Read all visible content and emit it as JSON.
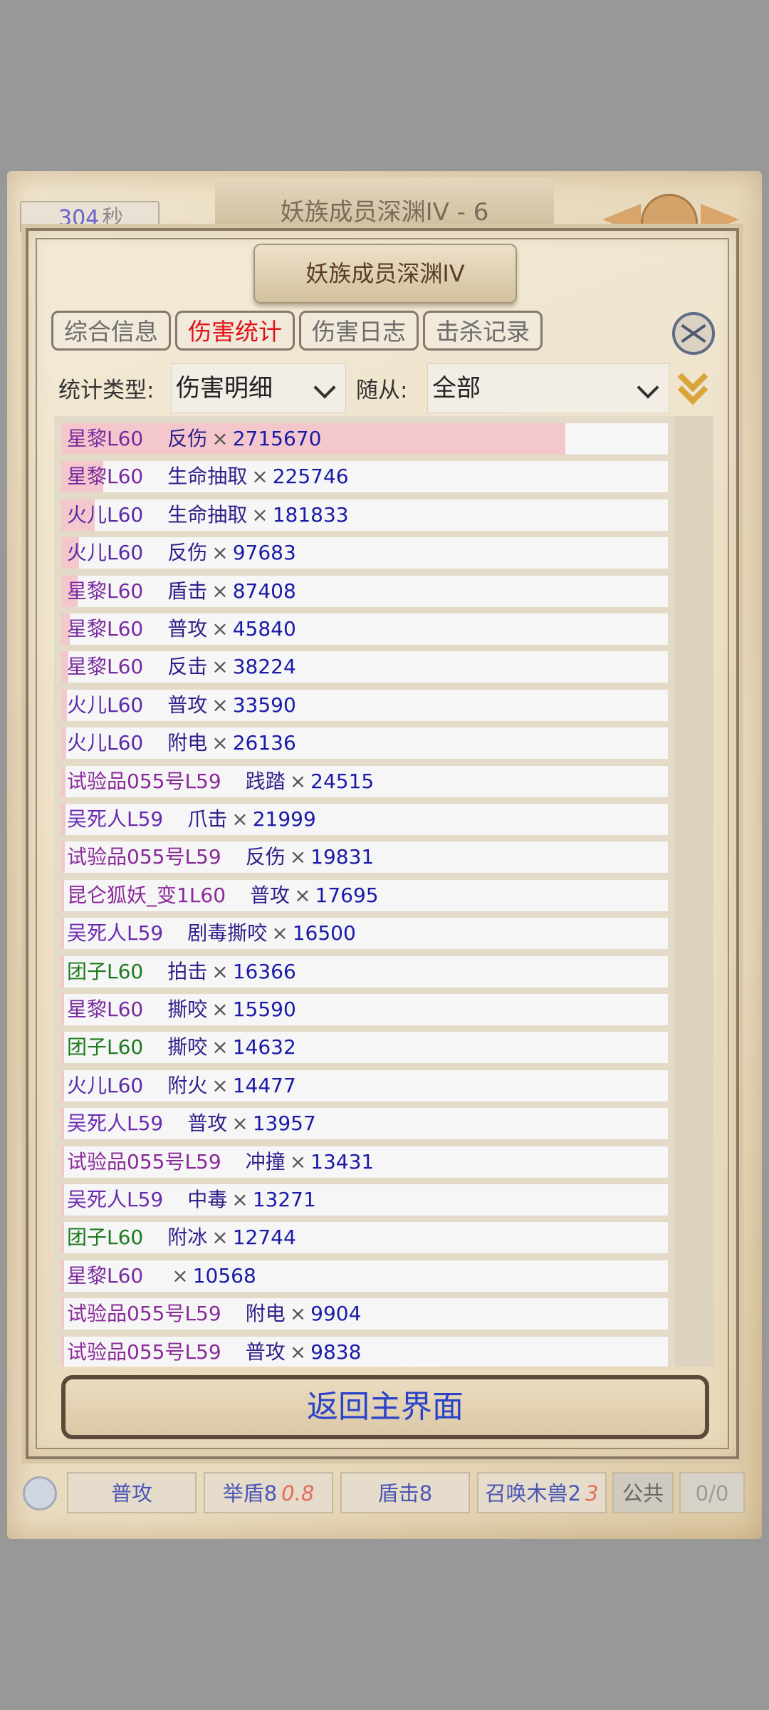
{
  "background": {
    "timer_value": "304",
    "timer_unit": "秒",
    "title": "妖族成员深渊IV - 6",
    "level": "4"
  },
  "dialog": {
    "title": "妖族成员深渊IV",
    "tabs": [
      {
        "label": "综合信息",
        "active": false
      },
      {
        "label": "伤害统计",
        "active": true
      },
      {
        "label": "伤害日志",
        "active": false
      },
      {
        "label": "击杀记录",
        "active": false
      }
    ],
    "filters": {
      "type_label": "统计类型:",
      "type_value": "伤害明细",
      "follower_label": "随从:",
      "follower_value": "全部"
    },
    "rows": [
      {
        "name": "星黎L60",
        "name_color": "#7a2aa0",
        "skill": "反伤",
        "value": "2715670",
        "fill": 1.0
      },
      {
        "name": "星黎L60",
        "name_color": "#7a2aa0",
        "skill": "生命抽取",
        "value": "225746",
        "fill": 0.083
      },
      {
        "name": "火儿L60",
        "name_color": "#5a2aa8",
        "skill": "生命抽取",
        "value": "181833",
        "fill": 0.067
      },
      {
        "name": "火儿L60",
        "name_color": "#5a2aa8",
        "skill": "反伤",
        "value": "97683",
        "fill": 0.036
      },
      {
        "name": "星黎L60",
        "name_color": "#7a2aa0",
        "skill": "盾击",
        "value": "87408",
        "fill": 0.032
      },
      {
        "name": "星黎L60",
        "name_color": "#7a2aa0",
        "skill": "普攻",
        "value": "45840",
        "fill": 0.017
      },
      {
        "name": "星黎L60",
        "name_color": "#7a2aa0",
        "skill": "反击",
        "value": "38224",
        "fill": 0.014
      },
      {
        "name": "火儿L60",
        "name_color": "#5a2aa8",
        "skill": "普攻",
        "value": "33590",
        "fill": 0.012
      },
      {
        "name": "火儿L60",
        "name_color": "#5a2aa8",
        "skill": "附电",
        "value": "26136",
        "fill": 0.01
      },
      {
        "name": "试验品055号L59",
        "name_color": "#8a2a9a",
        "skill": "践踏",
        "value": "24515",
        "fill": 0.009
      },
      {
        "name": "吴死人L59",
        "name_color": "#6a2ab0",
        "skill": "爪击",
        "value": "21999",
        "fill": 0.008
      },
      {
        "name": "试验品055号L59",
        "name_color": "#8a2a9a",
        "skill": "反伤",
        "value": "19831",
        "fill": 0.007
      },
      {
        "name": "昆仑狐妖_变1L60",
        "name_color": "#8a2a9a",
        "skill": "普攻",
        "value": "17695",
        "fill": 0.006
      },
      {
        "name": "吴死人L59",
        "name_color": "#6a2ab0",
        "skill": "剧毒撕咬",
        "value": "16500",
        "fill": 0.006
      },
      {
        "name": "团子L60",
        "name_color": "#1e7a1e",
        "skill": "拍击",
        "value": "16366",
        "fill": 0.006
      },
      {
        "name": "星黎L60",
        "name_color": "#7a2aa0",
        "skill": "撕咬",
        "value": "15590",
        "fill": 0.006
      },
      {
        "name": "团子L60",
        "name_color": "#1e7a1e",
        "skill": "撕咬",
        "value": "14632",
        "fill": 0.005
      },
      {
        "name": "火儿L60",
        "name_color": "#5a2aa8",
        "skill": "附火",
        "value": "14477",
        "fill": 0.005
      },
      {
        "name": "吴死人L59",
        "name_color": "#6a2ab0",
        "skill": "普攻",
        "value": "13957",
        "fill": 0.005
      },
      {
        "name": "试验品055号L59",
        "name_color": "#8a2a9a",
        "skill": "冲撞",
        "value": "13431",
        "fill": 0.005
      },
      {
        "name": "吴死人L59",
        "name_color": "#6a2ab0",
        "skill": "中毒",
        "value": "13271",
        "fill": 0.005
      },
      {
        "name": "团子L60",
        "name_color": "#1e7a1e",
        "skill": "附冰",
        "value": "12744",
        "fill": 0.005
      },
      {
        "name": "星黎L60",
        "name_color": "#7a2aa0",
        "skill": "",
        "value": "10568",
        "fill": 0.004
      },
      {
        "name": "试验品055号L59",
        "name_color": "#8a2a9a",
        "skill": "附电",
        "value": "9904",
        "fill": 0.004
      },
      {
        "name": "试验品055号L59",
        "name_color": "#8a2a9a",
        "skill": "普攻",
        "value": "9838",
        "fill": 0.004
      }
    ],
    "times_symbol": "×",
    "return_label": "返回主界面"
  },
  "bottom_bar": {
    "buttons": [
      {
        "label": "普攻",
        "cooldown": ""
      },
      {
        "label": "举盾8",
        "cooldown": "0.8"
      },
      {
        "label": "盾击8",
        "cooldown": ""
      },
      {
        "label": "召唤木兽2",
        "cooldown": "3"
      }
    ],
    "public_label": "公共",
    "counter": "0/0"
  },
  "colors": {
    "active_tab": "#e0151b",
    "bar_fill": "#f3c7cc",
    "value_blue": "#1a1aa8",
    "return_text": "#2a43c9"
  }
}
